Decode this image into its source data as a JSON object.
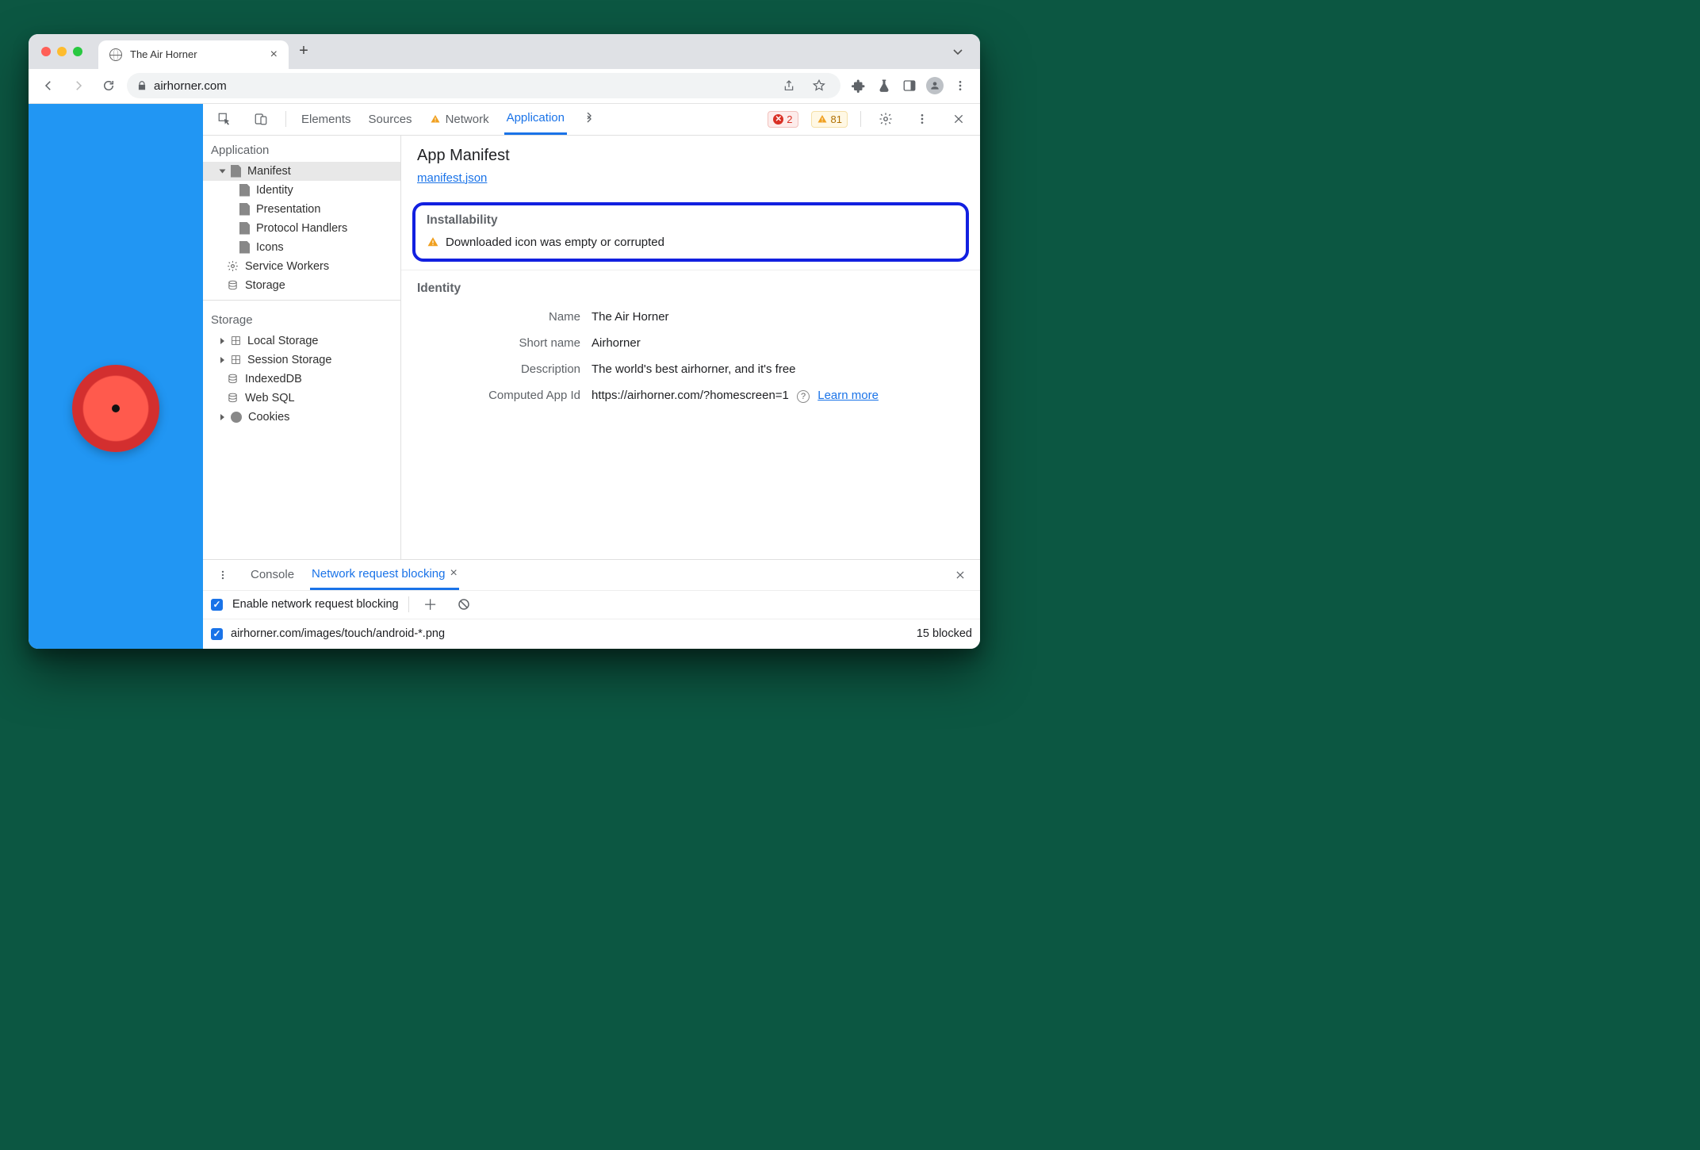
{
  "tab": {
    "title": "The Air Horner"
  },
  "address": {
    "host": "airhorner.com"
  },
  "devtools": {
    "tabs": {
      "elements": "Elements",
      "sources": "Sources",
      "network": "Network",
      "application": "Application"
    },
    "errors": 2,
    "warnings": 81
  },
  "sidebar": {
    "sections": {
      "application": "Application",
      "storage": "Storage"
    },
    "app_items": {
      "manifest": "Manifest",
      "identity": "Identity",
      "presentation": "Presentation",
      "protocol_handlers": "Protocol Handlers",
      "icons": "Icons",
      "service_workers": "Service Workers",
      "storage": "Storage"
    },
    "storage_items": {
      "local": "Local Storage",
      "session": "Session Storage",
      "indexeddb": "IndexedDB",
      "websql": "Web SQL",
      "cookies": "Cookies"
    }
  },
  "main": {
    "title": "App Manifest",
    "manifest_link": "manifest.json",
    "installability": {
      "heading": "Installability",
      "warning": "Downloaded icon was empty or corrupted"
    },
    "identity_heading": "Identity",
    "fields": {
      "name": {
        "label": "Name",
        "value": "The Air Horner"
      },
      "short_name": {
        "label": "Short name",
        "value": "Airhorner"
      },
      "description": {
        "label": "Description",
        "value": "The world's best airhorner, and it's free"
      },
      "app_id": {
        "label": "Computed App Id",
        "value": "https://airhorner.com/?homescreen=1",
        "learn_more": "Learn more"
      }
    }
  },
  "drawer": {
    "tabs": {
      "console": "Console",
      "nrb": "Network request blocking"
    },
    "enable_label": "Enable network request blocking",
    "pattern": "airhorner.com/images/touch/android-*.png",
    "blocked_text": "15 blocked"
  }
}
